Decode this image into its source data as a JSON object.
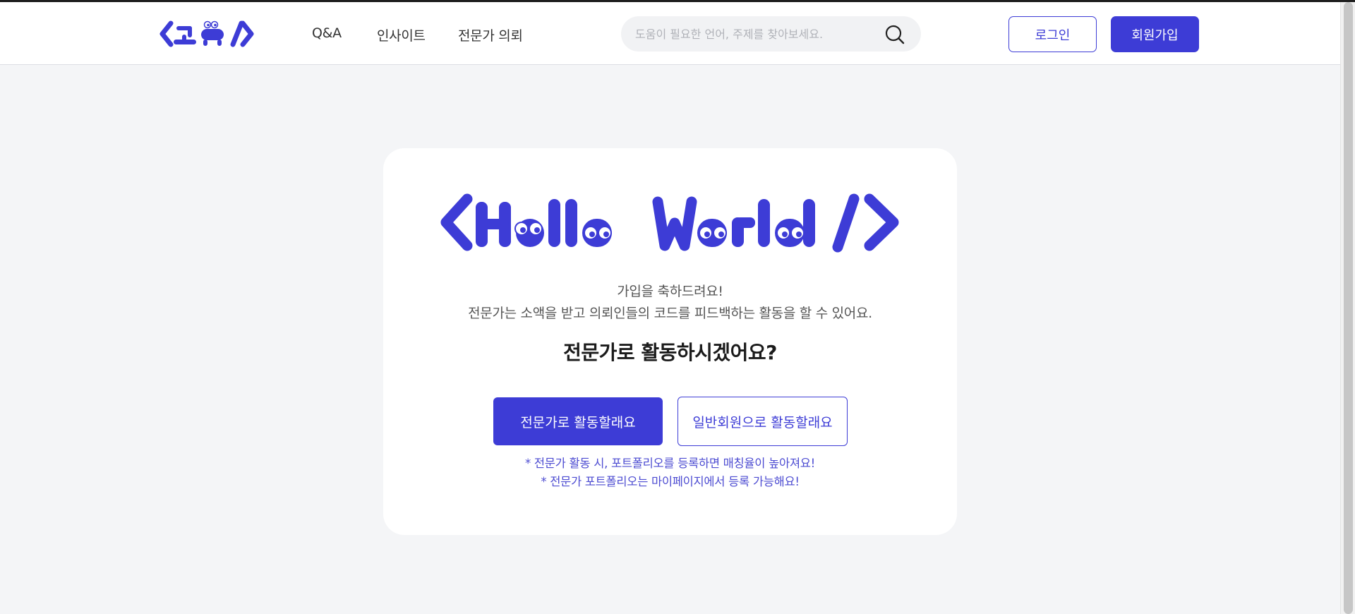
{
  "header": {
    "logo_text": "<코뮤/>",
    "nav": [
      {
        "label": "Q&A"
      },
      {
        "label": "인사이트"
      },
      {
        "label": "전문가 의뢰"
      }
    ],
    "search": {
      "placeholder": "도움이 필요한 언어, 주제를 찾아보세요.",
      "value": "",
      "icon": "search-icon"
    },
    "login_label": "로그인",
    "signup_label": "회원가입"
  },
  "card": {
    "hero_text": "<Hello World/>",
    "message_line1": "가입을 축하드려요!",
    "message_line2": "전문가는 소액을 받고 의뢰인들의 코드를 피드백하는 활동을 할 수 있어요.",
    "question": "전문가로 활동하시겠어요?",
    "expert_button": "전문가로 활동할래요",
    "general_button": "일반회원으로 활동할래요",
    "note1": "* 전문가 활동 시, 포트폴리오를 등록하면 매칭율이 높아져요!",
    "note2": "* 전문가 포트폴리오는 마이페이지에서 등록 가능해요!"
  },
  "colors": {
    "brand": "#3d3cd6",
    "page_background": "#f4f5f7",
    "card_background": "#ffffff"
  }
}
